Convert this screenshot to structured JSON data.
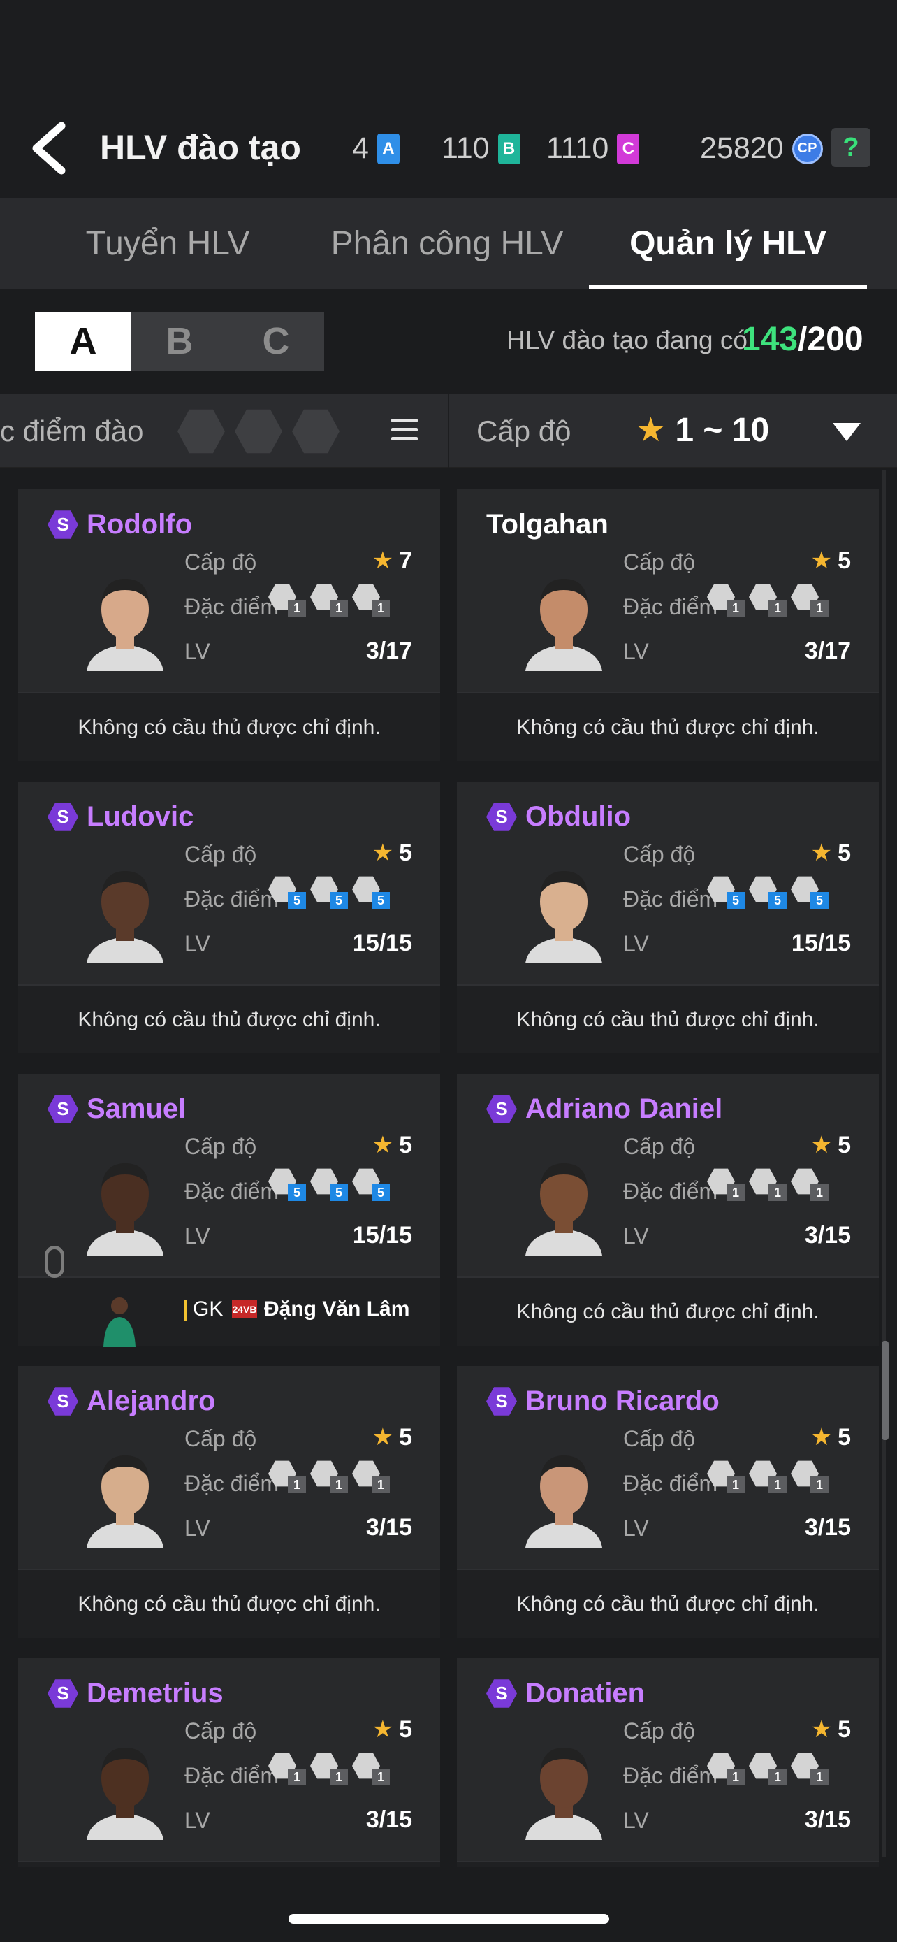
{
  "header": {
    "title": "HLV đào tạo",
    "back_icon": "chevron-left-icon",
    "currencies": [
      {
        "value": "4",
        "card": "A",
        "color": "#2f8fe8"
      },
      {
        "value": "110",
        "card": "B",
        "color": "#1fb59a"
      },
      {
        "value": "1110",
        "card": "C",
        "color": "#d23ad8"
      },
      {
        "value": "25820",
        "card": "CP",
        "color": "#3d7ce6"
      }
    ],
    "help_label": "?"
  },
  "tabs": [
    {
      "label": "Tuyển HLV",
      "active": false
    },
    {
      "label": "Phân công  HLV",
      "active": false
    },
    {
      "label": "Quản lý HLV",
      "active": true
    }
  ],
  "abc": [
    "A",
    "B",
    "C"
  ],
  "abc_active": "A",
  "count": {
    "label": "HLV đào tạo đang có",
    "current": "143",
    "max": "/200"
  },
  "filter": {
    "trait_label": "c điểm đào",
    "level_label": "Cấp độ",
    "level_star": "★",
    "level_range": "1 ~ 10"
  },
  "labels": {
    "level": "Cấp độ",
    "trait": "Đặc điểm",
    "trait_cut": "Đặc điểm",
    "lv": "LV",
    "none_assigned": "Không có cầu thủ được chỉ định."
  },
  "coaches": [
    {
      "name": "Rodolfo",
      "badge": "S",
      "stars": "7",
      "lv": "3/17",
      "trait_level": "1",
      "trait_color": "grey",
      "assigned": null
    },
    {
      "name": "Tolgahan",
      "badge": "",
      "stars": "5",
      "lv": "3/17",
      "trait_level": "1",
      "trait_color": "grey",
      "assigned": null
    },
    {
      "name": "Ludovic",
      "badge": "S",
      "stars": "5",
      "lv": "15/15",
      "trait_level": "5",
      "trait_color": "blue",
      "assigned": null
    },
    {
      "name": "Obdulio",
      "badge": "S",
      "stars": "5",
      "lv": "15/15",
      "trait_level": "5",
      "trait_color": "blue",
      "assigned": null
    },
    {
      "name": "Samuel",
      "badge": "S",
      "stars": "5",
      "lv": "15/15",
      "trait_level": "5",
      "trait_color": "blue",
      "assigned": {
        "position": "GK",
        "season": "24VB",
        "player": "Đặng Văn Lâm"
      }
    },
    {
      "name": "Adriano Daniel",
      "badge": "S",
      "stars": "5",
      "lv": "3/15",
      "trait_level": "1",
      "trait_color": "grey",
      "assigned": null
    },
    {
      "name": "Alejandro",
      "badge": "S",
      "stars": "5",
      "lv": "3/15",
      "trait_level": "1",
      "trait_color": "grey",
      "assigned": null
    },
    {
      "name": "Bruno Ricardo",
      "badge": "S",
      "stars": "5",
      "lv": "3/15",
      "trait_level": "1",
      "trait_color": "grey",
      "assigned": null
    },
    {
      "name": "Demetrius",
      "badge": "S",
      "stars": "5",
      "lv": "3/15",
      "trait_level": "1",
      "trait_color": "grey",
      "assigned": null
    },
    {
      "name": "Donatien",
      "badge": "S",
      "stars": "5",
      "lv": "3/15",
      "trait_level": "1",
      "trait_color": "grey",
      "assigned": null
    }
  ]
}
